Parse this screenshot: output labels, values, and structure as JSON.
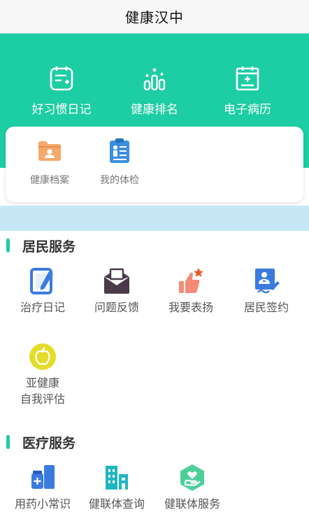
{
  "header": {
    "title": "健康汉中"
  },
  "hero": {
    "items": [
      {
        "label": "好习惯日记",
        "icon": "habit-diary-icon"
      },
      {
        "label": "健康排名",
        "icon": "ranking-icon"
      },
      {
        "label": "电子病历",
        "icon": "medical-record-icon"
      }
    ]
  },
  "card": {
    "items": [
      {
        "label": "健康档案",
        "icon": "health-file-folder-icon"
      },
      {
        "label": "我的体检",
        "icon": "checkup-clipboard-icon"
      }
    ]
  },
  "sections": [
    {
      "title": "居民服务",
      "items": [
        {
          "label": "治疗日记",
          "icon": "tablet-pen-icon"
        },
        {
          "label": "问题反馈",
          "icon": "envelope-icon"
        },
        {
          "label": "我要表扬",
          "icon": "thumbs-up-star-icon"
        },
        {
          "label": "居民签约",
          "icon": "doctor-sign-icon"
        },
        {
          "label": "亚健康",
          "label2": "自我评估",
          "icon": "apple-icon"
        }
      ]
    },
    {
      "title": "医疗服务",
      "items": [
        {
          "label": "用药小常识",
          "icon": "medicine-icon"
        },
        {
          "label": "健联体查询",
          "icon": "buildings-icon"
        },
        {
          "label": "健联体服务",
          "icon": "heart-hand-hexagon-icon"
        }
      ]
    }
  ],
  "colors": {
    "accent": "#1dcda4",
    "banner": "#c6e8f6",
    "folder": "#f5a86a",
    "clipboard": "#3a8fe0",
    "blue": "#3b7be0",
    "dark": "#4a3a4a",
    "thumb": "#f58a78",
    "apple": "#e5dc2a"
  }
}
